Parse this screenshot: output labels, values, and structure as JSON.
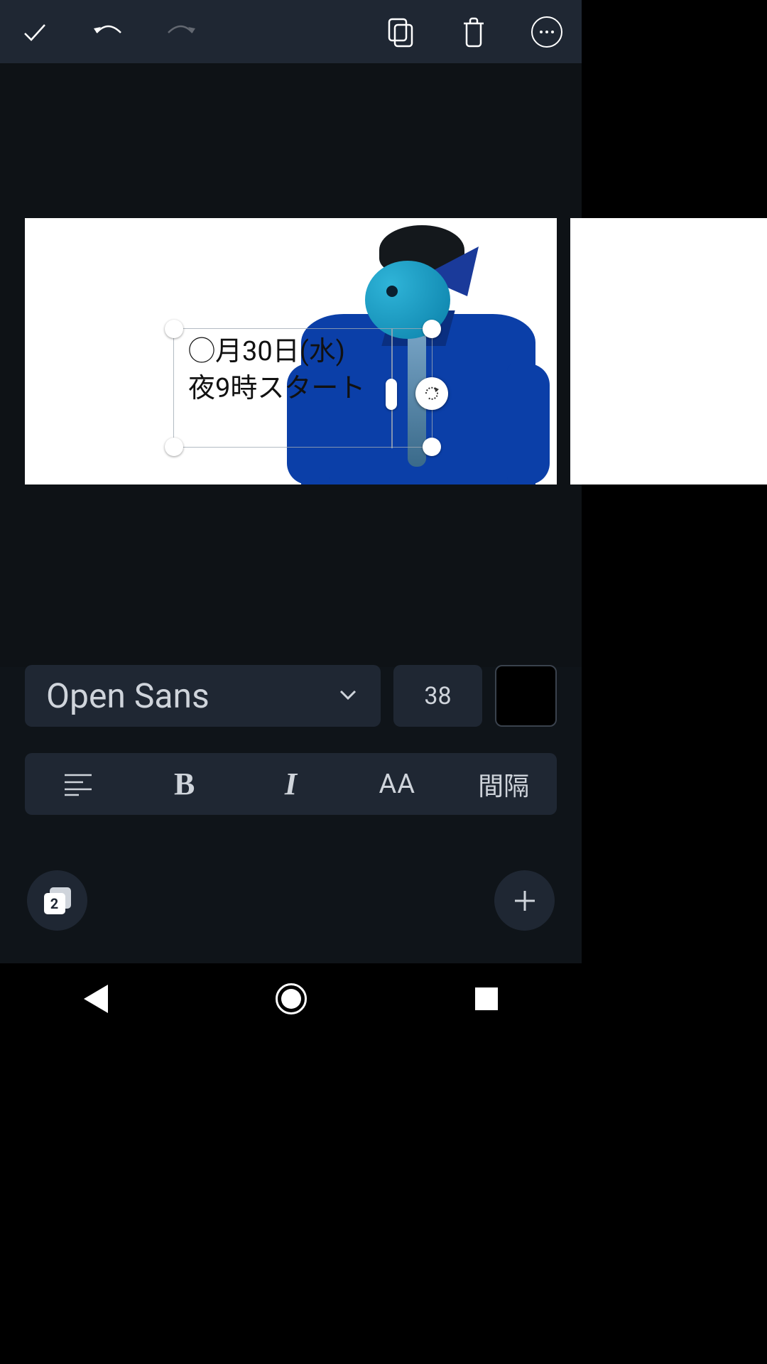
{
  "toolbar": {
    "confirm_icon": "checkmark-icon",
    "undo_icon": "undo-icon",
    "redo_icon": "redo-icon",
    "redo_disabled": true,
    "duplicate_icon": "copy-icon",
    "delete_icon": "trash-icon",
    "more_icon": "more-icon"
  },
  "canvas": {
    "text": {
      "line1": "◯月30日(水)",
      "line2": "夜9時スタート"
    }
  },
  "text_controls": {
    "font_name": "Open Sans",
    "font_size": "38",
    "color": "#000000",
    "bold_label": "B",
    "italic_label": "I",
    "case_label": "AA",
    "spacing_label": "間隔"
  },
  "pages": {
    "current": "2"
  }
}
